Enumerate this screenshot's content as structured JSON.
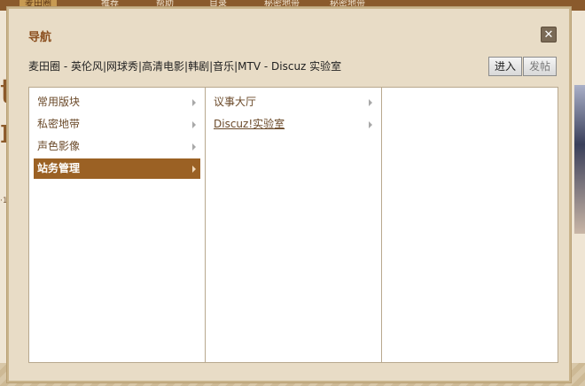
{
  "background": {
    "nav_tabs": [
      "麦田圈",
      "推荐",
      "帮助",
      "目录",
      "秘密地带",
      "秘密地带"
    ]
  },
  "dialog": {
    "title": "导航",
    "close_symbol": "✕",
    "forum_path": "麦田圈 - 英伦风|网球秀|高清电影|韩剧|音乐|MTV - Discuz 实验室",
    "buttons": {
      "enter": "进入",
      "post": "发帖"
    },
    "columns": [
      {
        "items": [
          {
            "label": "常用版块",
            "has_submenu": true,
            "selected": false
          },
          {
            "label": "私密地带",
            "has_submenu": true,
            "selected": false
          },
          {
            "label": "声色影像",
            "has_submenu": true,
            "selected": false
          },
          {
            "label": "站务管理",
            "has_submenu": true,
            "selected": true
          }
        ]
      },
      {
        "items": [
          {
            "label": "议事大厅",
            "has_submenu": true,
            "selected": false
          },
          {
            "label": "Discuz!实验室",
            "has_submenu": true,
            "selected": false,
            "highlighted": true
          }
        ]
      },
      {
        "items": []
      }
    ]
  },
  "colors": {
    "selected_bg": "#9b6124",
    "title": "#8b4f1f",
    "link": "#6b4a2a"
  }
}
